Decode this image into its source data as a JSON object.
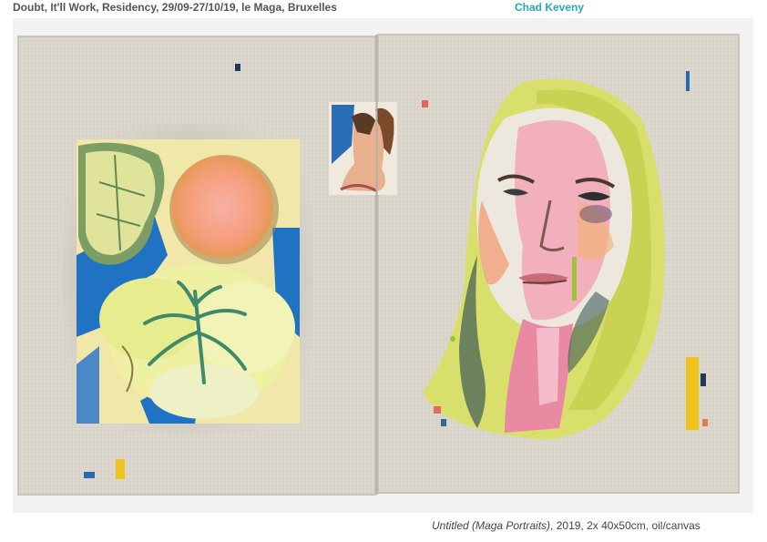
{
  "header": {
    "title": "Doubt, It'll Work, Residency, 29/09-27/10/19, le Maga, Bruxelles",
    "artist": "Chad Keveny"
  },
  "caption": {
    "title": "Untitled (Maga Portraits)",
    "details": ", 2019, 2x 40x50cm, oil/canvas"
  },
  "colors": {
    "canvas": "#dcd7cd",
    "wall": "#f2f2f0",
    "blue": "#1f73c2",
    "lime": "#d9e07a",
    "peach": "#f3a07a",
    "pink": "#f0a6b6",
    "yellow": "#f1c41d"
  }
}
